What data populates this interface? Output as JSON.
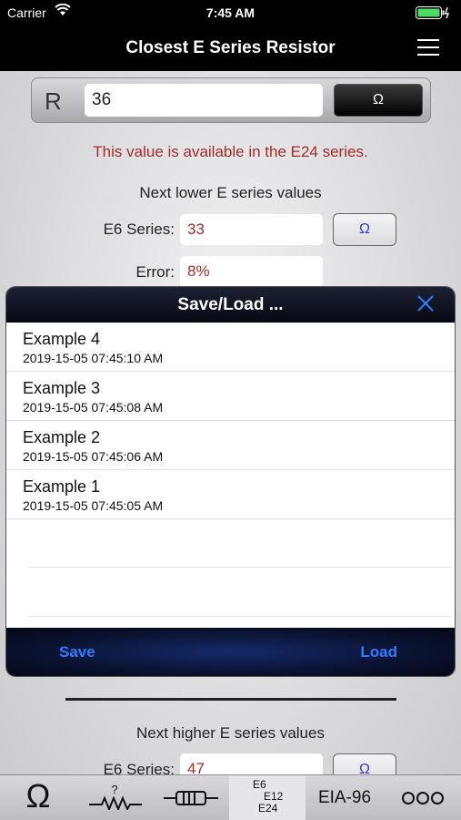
{
  "status_bar": {
    "carrier": "Carrier",
    "time": "7:45 AM"
  },
  "nav": {
    "title": "Closest E Series Resistor"
  },
  "resistance": {
    "label": "R",
    "value": "36",
    "unit_button": "Ω"
  },
  "availability_message": "This value is available in the E24 series.",
  "lower": {
    "title": "Next lower E series values",
    "series_label": "E6 Series:",
    "series_value": "33",
    "unit_button": "Ω",
    "error_label": "Error:",
    "error_value": "8%"
  },
  "higher": {
    "title": "Next higher E series values",
    "series_label": "E6 Series:",
    "series_value": "47",
    "unit_button": "Ω"
  },
  "modal": {
    "title": "Save/Load ...",
    "items": [
      {
        "name": "Example 4",
        "date": "2019-15-05 07:45:10 AM"
      },
      {
        "name": "Example 3",
        "date": "2019-15-05 07:45:08 AM"
      },
      {
        "name": "Example 2",
        "date": "2019-15-05 07:45:06 AM"
      },
      {
        "name": "Example 1",
        "date": "2019-15-05 07:45:05 AM"
      }
    ],
    "save_label": "Save",
    "load_label": "Load"
  },
  "tab_bar": {
    "tabs": [
      {
        "icon": "ohm-icon",
        "label": "Ω"
      },
      {
        "icon": "unknown-resistor-icon",
        "label": "?"
      },
      {
        "icon": "resistor-icon",
        "label": ""
      },
      {
        "icon": "e-series-icon",
        "lines": [
          "E6",
          "E12",
          "E24"
        ]
      },
      {
        "icon": "eia96-icon",
        "label": "EIA-96"
      },
      {
        "icon": "more-icon",
        "label": ""
      }
    ]
  },
  "colors": {
    "accent_blue": "#2f7bff",
    "value_red": "#a32b2b",
    "button_blue": "#2a3cc6"
  }
}
